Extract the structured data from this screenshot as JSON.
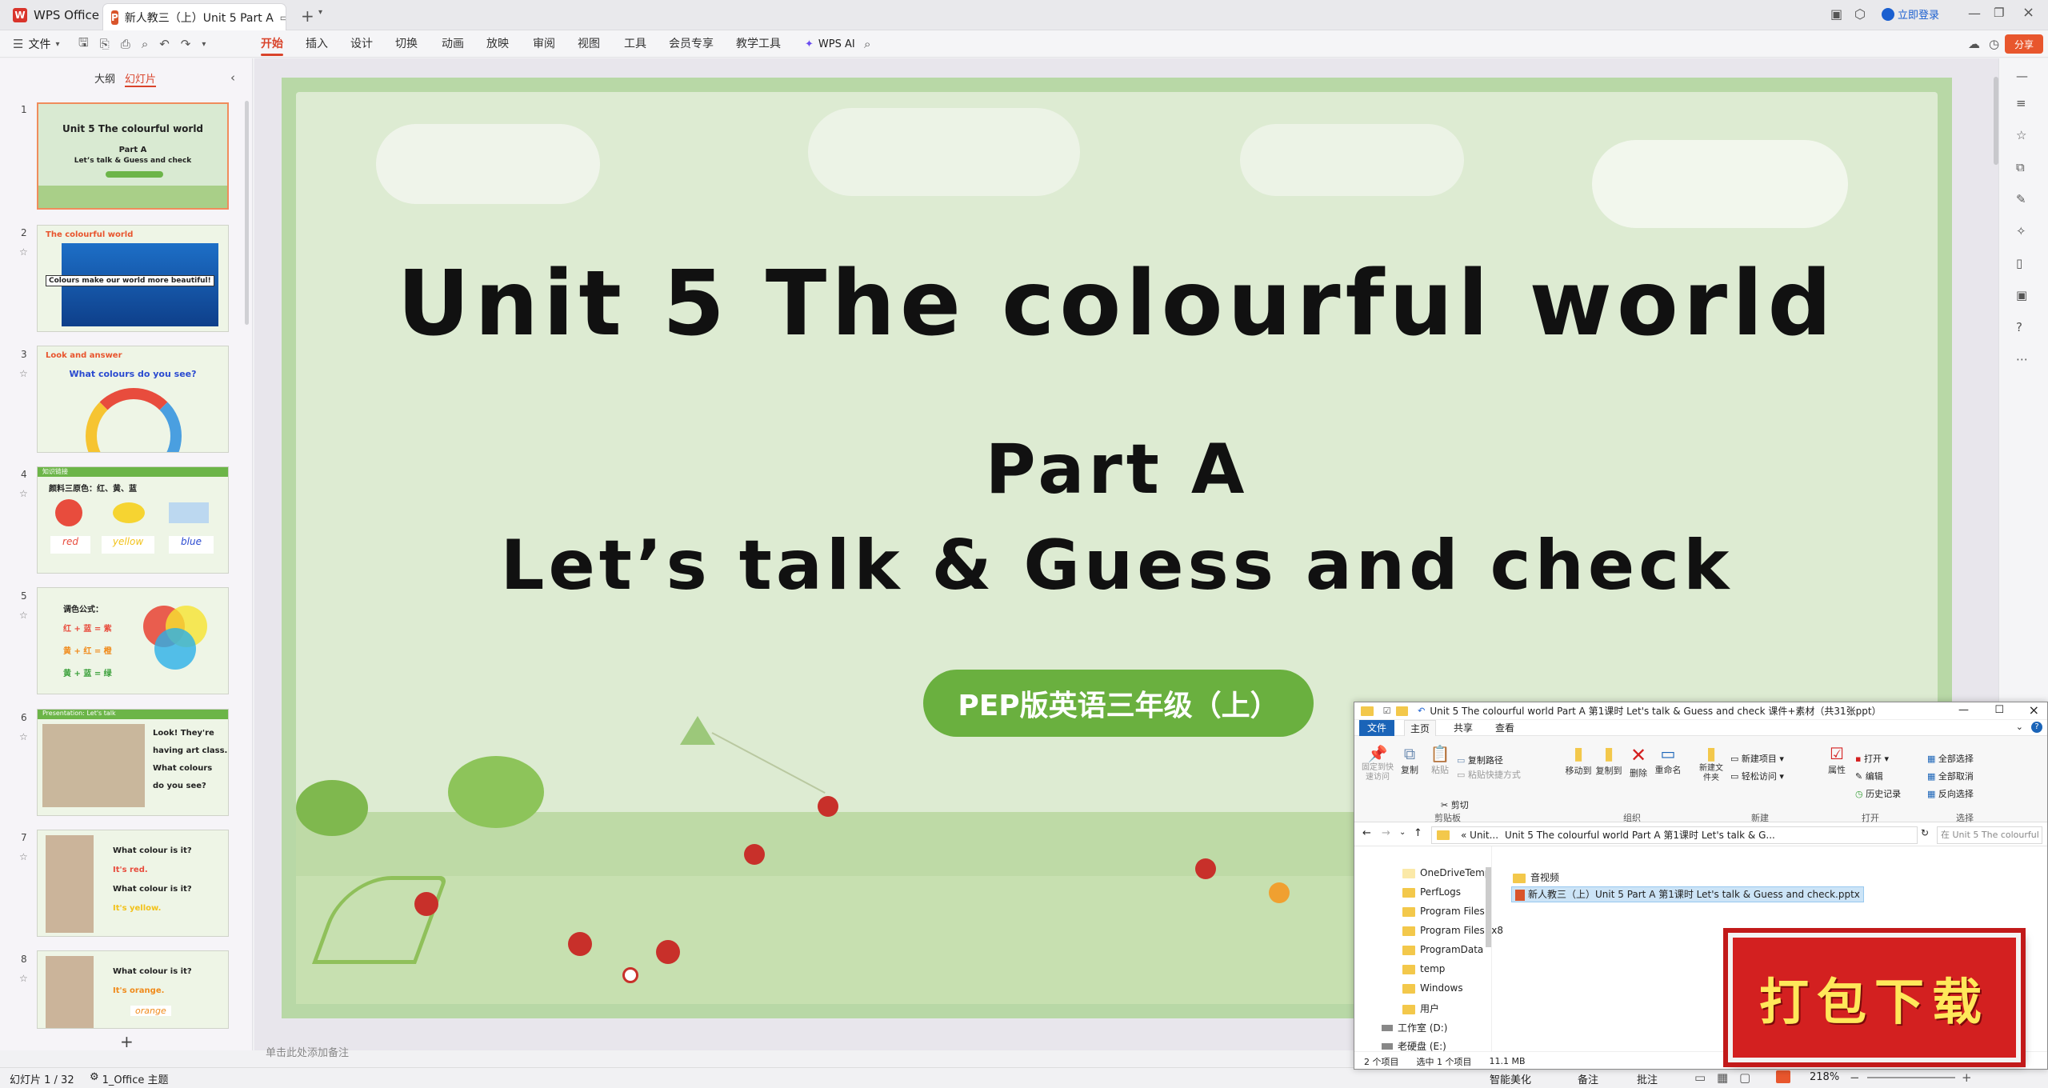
{
  "titlebar": {
    "app_name": "WPS Office",
    "doc_tab": "新人教三（上）Unit 5 Part A",
    "login": "立即登录"
  },
  "menu": {
    "file": "文件",
    "tabs": [
      "开始",
      "插入",
      "设计",
      "切换",
      "动画",
      "放映",
      "审阅",
      "视图",
      "工具",
      "会员专享",
      "教学工具"
    ],
    "ai": "WPS AI",
    "share": "分享"
  },
  "panel": {
    "outline_tab": "大纲",
    "slides_tab": "幻灯片",
    "add": "+"
  },
  "thumbs": [
    {
      "num": "1",
      "title": "Unit 5  The colourful world",
      "sub1": "Part A",
      "sub2": "Let’s talk & Guess and check"
    },
    {
      "num": "2",
      "title": "The colourful world",
      "caption": "Colours make our world more beautiful!"
    },
    {
      "num": "3",
      "title": "Look and answer",
      "question": "What colours do you see?"
    },
    {
      "num": "4",
      "title": "知识链接",
      "line": "颜料三原色：红、黄、蓝",
      "w1": "red",
      "w2": "yellow",
      "w3": "blue"
    },
    {
      "num": "5",
      "title": "调色公式：",
      "f1": "红 + 蓝 = 紫",
      "f2": "黄 + 红 = 橙",
      "f3": "黄 + 蓝 = 绿"
    },
    {
      "num": "6",
      "title": "Presentation: Let's talk",
      "t1": "Look! They're",
      "t2": "having art class.",
      "t3": "What colours",
      "t4": "do you see?"
    },
    {
      "num": "7",
      "q1": "What colour is it?",
      "a1": "It's red.",
      "q2": "What colour is it?",
      "a2": "It's yellow."
    },
    {
      "num": "8",
      "q1": "What colour is it?",
      "a1": "It's orange.",
      "w": "orange"
    }
  ],
  "slide": {
    "title": "Unit 5  The colourful world",
    "part": "Part A",
    "subtitle": "Let’s talk & Guess and check",
    "badge": "PEP版英语三年级（上）"
  },
  "notes_placeholder": "单击此处添加备注",
  "status": {
    "slide_count": "幻灯片 1 / 32",
    "theme": "1_Office 主题",
    "beautify": "智能美化",
    "notes": "备注",
    "comments": "批注",
    "zoom": "218%"
  },
  "explorer": {
    "title": "Unit 5 The colourful world  Part A 第1课时 Let's talk & Guess and check 课件+素材（共31张ppt）",
    "ribbon_tabs": [
      "文件",
      "主页",
      "共享",
      "查看"
    ],
    "buttons": {
      "pin": "固定到快速访问",
      "copy": "复制",
      "paste": "粘贴",
      "copy_path": "复制路径",
      "paste_shortcut": "粘贴快捷方式",
      "cut": "剪切",
      "move_to": "移动到",
      "copy_to": "复制到",
      "delete": "删除",
      "rename": "重命名",
      "new_folder": "新建文件夹",
      "new_item": "新建项目",
      "easy_access": "轻松访问",
      "properties": "属性",
      "open": "打开",
      "edit": "编辑",
      "history": "历史记录",
      "select_all": "全部选择",
      "select_none": "全部取消",
      "invert": "反向选择"
    },
    "groups": [
      "剪贴板",
      "组织",
      "新建",
      "打开",
      "选择"
    ],
    "address": "Unit 5 The colourful world  Part A 第1课时 Let's talk & G...",
    "address_prefix": "« Unit...",
    "search_placeholder": "在 Unit 5 The colourful world  Pa...",
    "tree": [
      "OneDriveTemp",
      "PerfLogs",
      "Program Files",
      "Program Files (x8",
      "ProgramData",
      "temp",
      "Windows",
      "用户",
      "工作室 (D:)",
      "老硬盘 (E:)"
    ],
    "files": [
      "音视频",
      "新人教三（上）Unit 5 Part A 第1课时 Let's talk & Guess and check.pptx"
    ],
    "status_items": "2 个项目",
    "status_selected": "选中 1 个项目",
    "status_size": "11.1 MB"
  },
  "download_badge": "打包下载"
}
